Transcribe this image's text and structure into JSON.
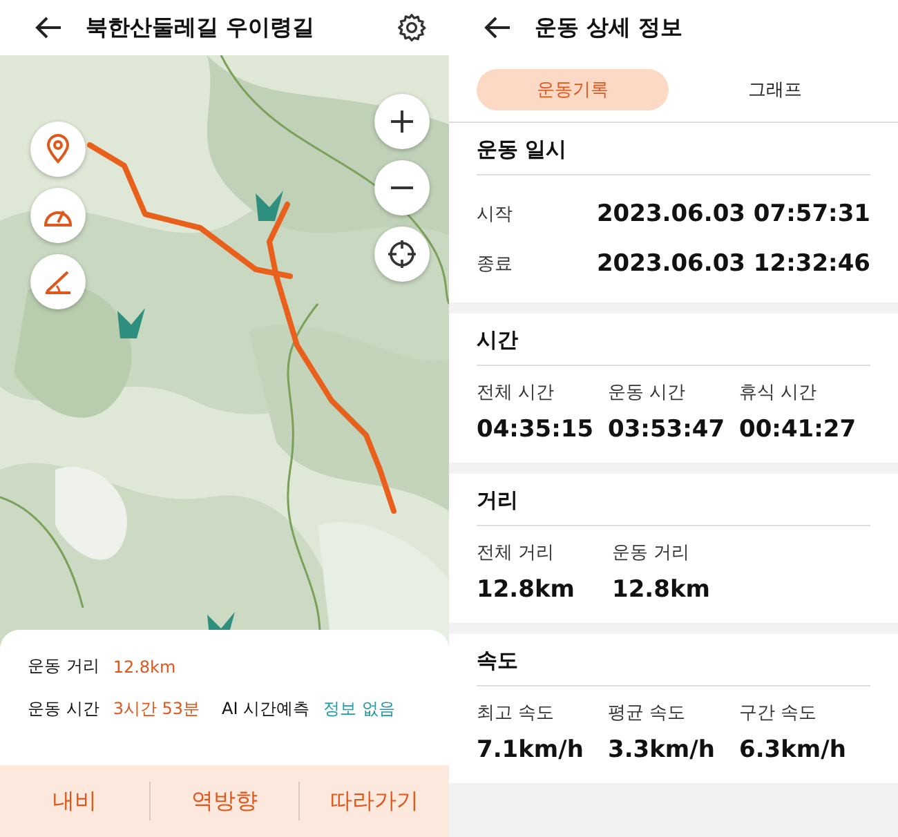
{
  "route_screen": {
    "title": "북한산둘레길 우이령길",
    "map": {
      "kind": "picture"
    },
    "summary": [
      [
        {
          "label": "운동 거리",
          "value": "12.8km",
          "color": "#e0561b"
        }
      ],
      [
        {
          "label": "운동 시간",
          "value": "3시간 53분",
          "color": "#e0561b"
        },
        {
          "label": "AI 시간예측",
          "value": "정보 없음",
          "color": "#1f9aa6"
        }
      ]
    ],
    "actions": [
      "내비",
      "역방향",
      "따라가기"
    ]
  },
  "detail_screen": {
    "title": "운동 상세 정보",
    "tabs": [
      {
        "label": "운동기록",
        "selected": true
      },
      {
        "label": "그래프",
        "selected": false
      }
    ],
    "sections": [
      {
        "title": "운동 일시",
        "kind": "rows",
        "items": [
          {
            "label": "시작",
            "value": "2023.06.03 07:57:31"
          },
          {
            "label": "종료",
            "value": "2023.06.03 12:32:46"
          }
        ]
      },
      {
        "title": "시간",
        "kind": "columns",
        "items": [
          {
            "label": "전체 시간",
            "value": "04:35:15"
          },
          {
            "label": "운동 시간",
            "value": "03:53:47"
          },
          {
            "label": "휴식 시간",
            "value": "00:41:27"
          }
        ]
      },
      {
        "title": "거리",
        "kind": "columns",
        "items": [
          {
            "label": "전체 거리",
            "value": "12.8km"
          },
          {
            "label": "운동 거리",
            "value": "12.8km"
          }
        ]
      },
      {
        "title": "속도",
        "kind": "columns",
        "items": [
          {
            "label": "최고 속도",
            "value": "7.1km/h"
          },
          {
            "label": "평균 속도",
            "value": "3.3km/h"
          },
          {
            "label": "구간 속도",
            "value": "6.3km/h"
          }
        ]
      }
    ]
  }
}
